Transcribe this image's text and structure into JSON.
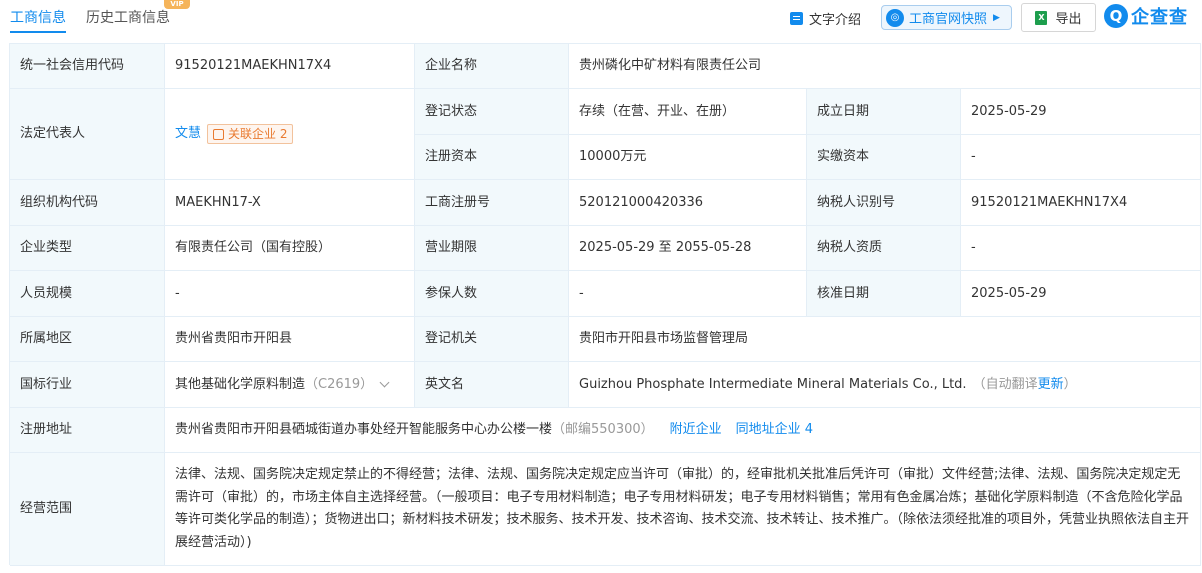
{
  "tabs": {
    "business": "工商信息",
    "history": "历史工商信息",
    "vip": "VIP"
  },
  "toolbar": {
    "text_intro": "文字介绍",
    "snapshot": "工商官网快照",
    "export": "导出",
    "brand": "企查查",
    "brand_logo": "Q"
  },
  "labels": {
    "credit_code": "统一社会信用代码",
    "company_name": "企业名称",
    "legal_rep": "法定代表人",
    "reg_status": "登记状态",
    "established": "成立日期",
    "reg_capital": "注册资本",
    "paid_capital": "实缴资本",
    "org_code": "组织机构代码",
    "reg_number": "工商注册号",
    "taxpayer_id": "纳税人识别号",
    "company_type": "企业类型",
    "business_term": "营业期限",
    "taxpayer_qualification": "纳税人资质",
    "staff_size": "人员规模",
    "insured": "参保人数",
    "approval_date": "核准日期",
    "region": "所属地区",
    "authority": "登记机关",
    "industry": "国标行业",
    "english_name": "英文名",
    "address": "注册地址",
    "scope": "经营范围"
  },
  "values": {
    "credit_code": "91520121MAEKHN17X4",
    "company_name": "贵州磷化中矿材料有限责任公司",
    "legal_rep": "文慧",
    "related_companies": "关联企业 2",
    "reg_status": "存续（在营、开业、在册）",
    "established": "2025-05-29",
    "reg_capital": "10000万元",
    "paid_capital": "-",
    "org_code": "MAEKHN17-X",
    "reg_number": "520121000420336",
    "taxpayer_id": "91520121MAEKHN17X4",
    "company_type": "有限责任公司（国有控股）",
    "business_term": "2025-05-29 至 2055-05-28",
    "taxpayer_qualification": "-",
    "staff_size": "-",
    "insured": "-",
    "approval_date": "2025-05-29",
    "region": "贵州省贵阳市开阳县",
    "authority": "贵阳市开阳县市场监督管理局",
    "industry": "其他基础化学原料制造",
    "industry_code": "（C2619）",
    "english_name": "Guizhou Phosphate Intermediate Mineral Materials Co., Ltd.",
    "auto_translate": "（自动翻译",
    "update": "更新",
    "auto_translate_close": "）",
    "address": "贵州省贵阳市开阳县硒城街道办事处经开智能服务中心办公楼一楼",
    "postcode": "（邮编550300）",
    "nearby": "附近企业",
    "same_address": "同地址企业 4",
    "scope": "法律、法规、国务院决定规定禁止的不得经营；法律、法规、国务院决定规定应当许可（审批）的，经审批机关批准后凭许可（审批）文件经营;法律、法规、国务院决定规定无需许可（审批）的，市场主体自主选择经营。（一般项目：电子专用材料制造；电子专用材料研发；电子专用材料销售；常用有色金属冶炼；基础化学原料制造（不含危险化学品等许可类化学品的制造）；货物进出口；新材料技术研发；技术服务、技术开发、技术咨询、技术交流、技术转让、技术推广。（除依法须经批准的项目外，凭营业执照依法自主开展经营活动）)"
  },
  "colors": {
    "accent": "#128bed",
    "label_bg": "#f2f9fc",
    "border": "#e4eef6",
    "badge": "#e97a30"
  }
}
